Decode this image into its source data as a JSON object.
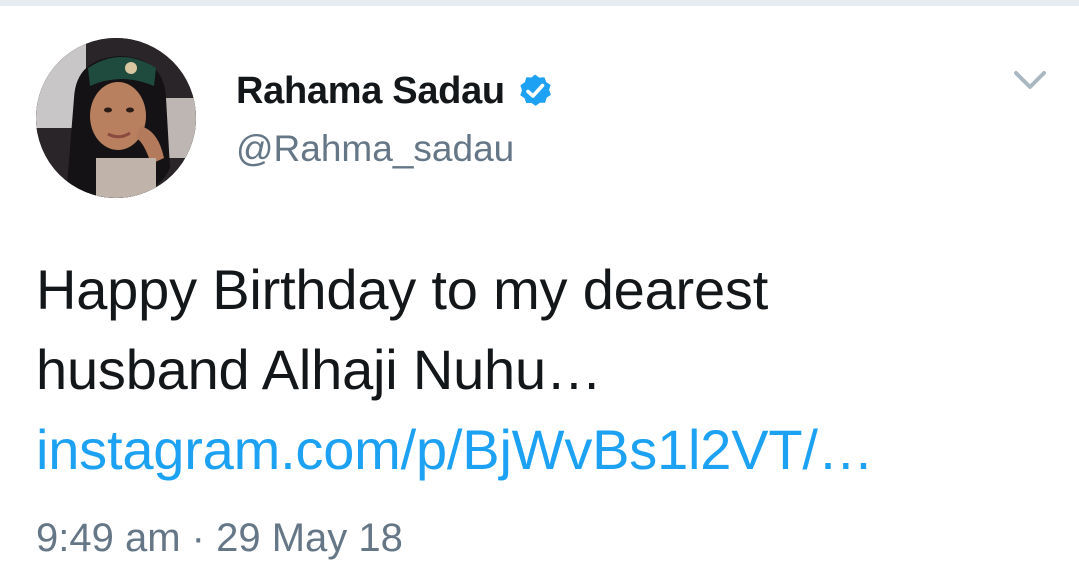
{
  "tweet": {
    "display_name": "Rahama Sadau",
    "handle": "@Rahma_sadau",
    "verified": true,
    "text_line1": "Happy Birthday to my dearest",
    "text_line2": "husband Alhaji Nuhu…",
    "link_text": "instagram.com/p/BjWvBs1l2VT/…",
    "time": "9:49 am",
    "separator": "·",
    "date": "29 May 18"
  },
  "icons": {
    "verified": "verified-badge-icon",
    "menu": "chevron-down-icon"
  },
  "colors": {
    "text": "#14171a",
    "secondary": "#657786",
    "link": "#1da1f2",
    "verified": "#1da1f2"
  }
}
